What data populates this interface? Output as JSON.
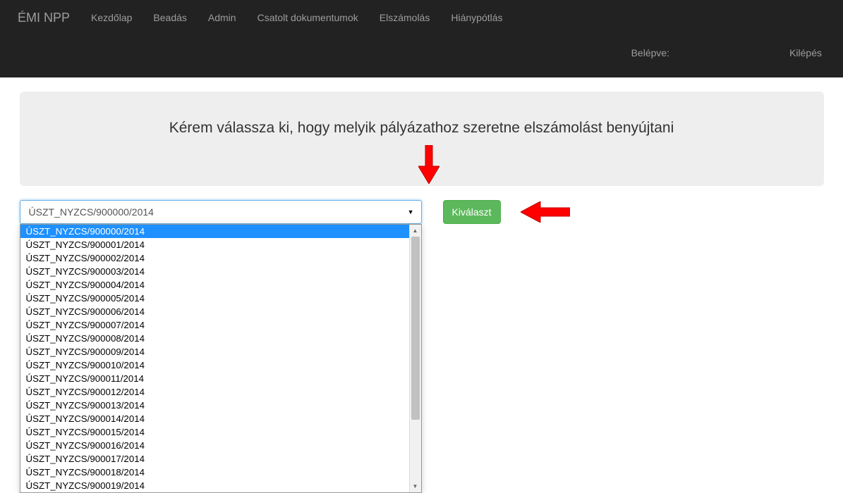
{
  "navbar": {
    "brand": "ÉMI NPP",
    "links": [
      "Kezdőlap",
      "Beadás",
      "Admin",
      "Csatolt dokumentumok",
      "Elszámolás",
      "Hiánypótlás"
    ],
    "logged_in_label": "Belépve:",
    "logout_label": "Kilépés"
  },
  "main": {
    "heading": "Kérem válassza ki, hogy melyik pályázathoz szeretne elszámolást benyújtani",
    "select_button": "Kiválaszt",
    "selected_value": "ÚSZT_NYZCS/900000/2014",
    "options": [
      "ÚSZT_NYZCS/900000/2014",
      "ÚSZT_NYZCS/900001/2014",
      "ÚSZT_NYZCS/900002/2014",
      "ÚSZT_NYZCS/900003/2014",
      "ÚSZT_NYZCS/900004/2014",
      "ÚSZT_NYZCS/900005/2014",
      "ÚSZT_NYZCS/900006/2014",
      "ÚSZT_NYZCS/900007/2014",
      "ÚSZT_NYZCS/900008/2014",
      "ÚSZT_NYZCS/900009/2014",
      "ÚSZT_NYZCS/900010/2014",
      "ÚSZT_NYZCS/900011/2014",
      "ÚSZT_NYZCS/900012/2014",
      "ÚSZT_NYZCS/900013/2014",
      "ÚSZT_NYZCS/900014/2014",
      "ÚSZT_NYZCS/900015/2014",
      "ÚSZT_NYZCS/900016/2014",
      "ÚSZT_NYZCS/900017/2014",
      "ÚSZT_NYZCS/900018/2014",
      "ÚSZT_NYZCS/900019/2014"
    ]
  }
}
